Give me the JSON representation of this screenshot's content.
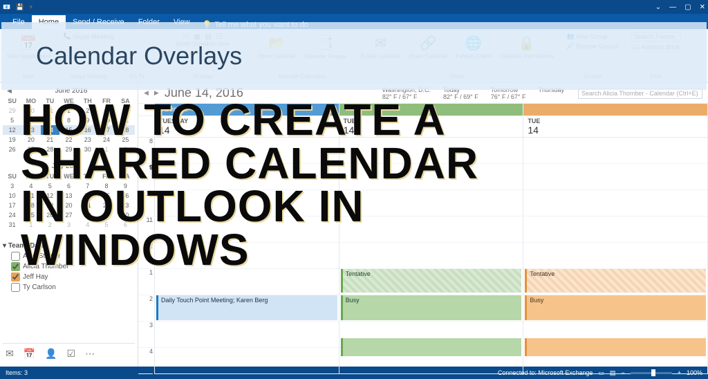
{
  "overlay": {
    "banner": "Calendar Overlays",
    "title_l1": "HOW TO CREATE A",
    "title_l2": "SHARED CALENDAR",
    "title_l3": "IN OUTLOOK IN",
    "title_l4": "WINDOWS"
  },
  "titlebar": {
    "title": "",
    "minimize": "—",
    "maximize": "▢",
    "close": "✕"
  },
  "menu": {
    "file": "File",
    "home": "Home",
    "send_receive": "Send / Receive",
    "folder": "Folder",
    "view": "View",
    "tell_me": "Tell me what you want to do"
  },
  "ribbon": {
    "new": "New",
    "new_appointment": "New\nAppointment",
    "skype": "Skype Meeting",
    "goto_label": "Go To",
    "arrange_label": "Arrange",
    "month_schedule": "Month Schedule\nView",
    "open_calendar": "Open\nCalendar",
    "calendar_groups": "Calendar\nGroups",
    "manage_label": "Manage Calendars",
    "email_calendar": "E-mail\nCalendar",
    "share_calendar": "Share\nCalendar",
    "publish": "Publish\nOnline",
    "permissions": "Calendar\nPermissions",
    "share_label": "Share",
    "new_group": "New Group",
    "browse_groups": "Browse Groups",
    "groups_label": "Groups",
    "search_people": "Search People",
    "address_book": "Address Book",
    "find_label": "Find"
  },
  "sidebar": {
    "cal1": {
      "month": "June 2016",
      "dow": [
        "SU",
        "MO",
        "TU",
        "WE",
        "TH",
        "FR",
        "SA"
      ],
      "weeks": [
        [
          "29",
          "30",
          "31",
          "1",
          "2",
          "3",
          "4"
        ],
        [
          "5",
          "6",
          "7",
          "8",
          "9",
          "10",
          "11"
        ],
        [
          "12",
          "13",
          "14",
          "15",
          "16",
          "17",
          "18"
        ],
        [
          "19",
          "20",
          "21",
          "22",
          "23",
          "24",
          "25"
        ],
        [
          "26",
          "27",
          "28",
          "29",
          "30",
          "1",
          "2"
        ]
      ],
      "today": "14"
    },
    "cal2": {
      "month": "July 2016",
      "weeks": [
        [
          "3",
          "4",
          "5",
          "6",
          "7",
          "8",
          "9"
        ],
        [
          "10",
          "11",
          "12",
          "13",
          "14",
          "15",
          "16"
        ],
        [
          "17",
          "18",
          "19",
          "20",
          "21",
          "22",
          "23"
        ],
        [
          "24",
          "25",
          "26",
          "27",
          "28",
          "29",
          "30"
        ],
        [
          "31",
          "1",
          "2",
          "3",
          "4",
          "5",
          "6"
        ]
      ]
    },
    "team_header": "Team: Dan",
    "people": {
      "alan": "Alan Steiner",
      "alicia": "Alicia Thomber",
      "jeff": "Jeff Hay",
      "ty": "Ty Carlson"
    }
  },
  "calendar": {
    "date_title": "June 14, 2016",
    "weather": {
      "city1_name": "Washington, D.C.",
      "city1_temp": "82° F / 67° F",
      "city2_name": "Today",
      "city2_temp": "82° F / 69° F",
      "city3_name": "Tomorrow",
      "city3_temp": "76° F / 67° F",
      "city4_name": "Thursday"
    },
    "search_placeholder": "Search Alicia Thomber - Calendar (Ctrl+E)",
    "tabs": {
      "cal0": "Calend…",
      "day0": "TUESDAY",
      "num0": "14",
      "day1": "TUE",
      "num1": "14",
      "day2": "TUE",
      "num2": "14"
    },
    "hours": [
      "8",
      "9",
      "10",
      "11",
      "12",
      "1",
      "2",
      "3",
      "4"
    ],
    "bold_hour_index": 1,
    "events": {
      "daily_touch": "Daily Touch Point Meeting; Karen Berg",
      "tentative": "Tentative",
      "busy": "Busy"
    }
  },
  "status": {
    "items": "Items: 3",
    "connected": "Connected to: Microsoft Exchange",
    "zoom": "100%"
  }
}
